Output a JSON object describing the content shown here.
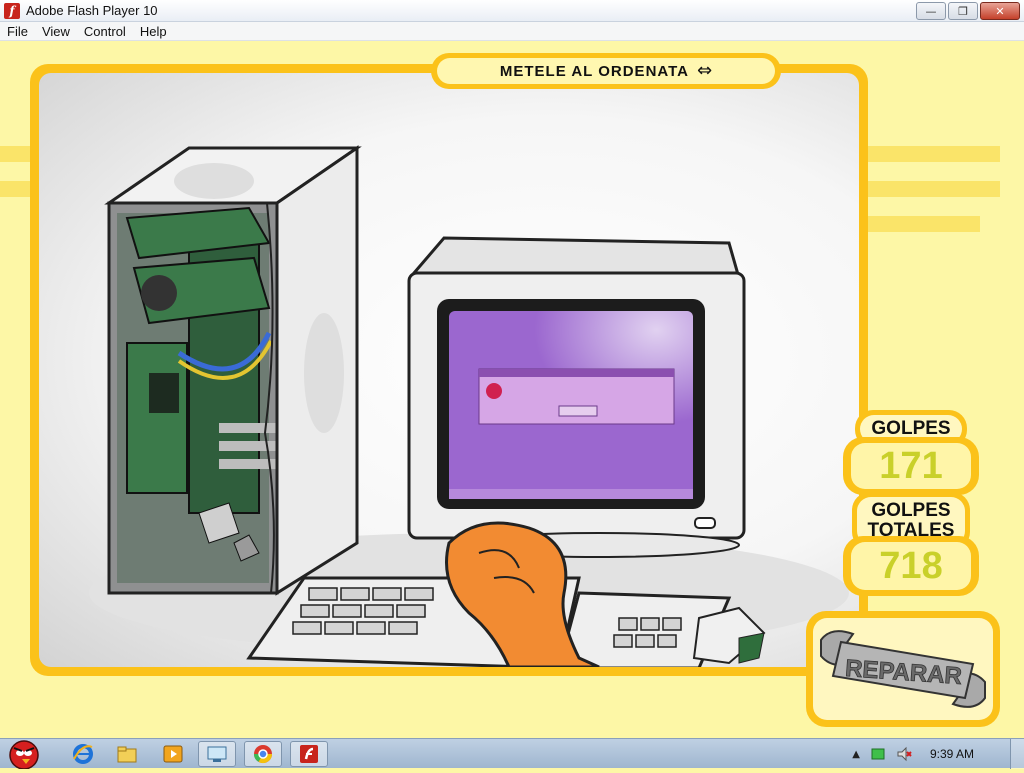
{
  "window": {
    "title": "Adobe Flash Player 10",
    "icon": "flash-icon",
    "controls": {
      "minimize": "—",
      "restore": "❐",
      "close": "✕"
    }
  },
  "menu": [
    "File",
    "View",
    "Control",
    "Help"
  ],
  "game": {
    "title": "METELE AL ORDENATA",
    "swap_icon": "⇔",
    "score": {
      "label": "GOLPES",
      "value": "171"
    },
    "total": {
      "label_line1": "GOLPES",
      "label_line2": "TOTALES",
      "value": "718"
    },
    "repair_label": "REPARAR",
    "colors": {
      "frame": "#fbc21a",
      "panel": "#fff7c0",
      "score_text": "#c9d02a",
      "background": "#fdf7a6"
    }
  },
  "taskbar": {
    "apps": [
      "angry-birds-icon",
      "internet-explorer-icon",
      "file-explorer-icon",
      "media-player-icon",
      "remote-desktop-icon",
      "chrome-icon",
      "flash-player-icon"
    ],
    "time": "9:39 AM"
  }
}
